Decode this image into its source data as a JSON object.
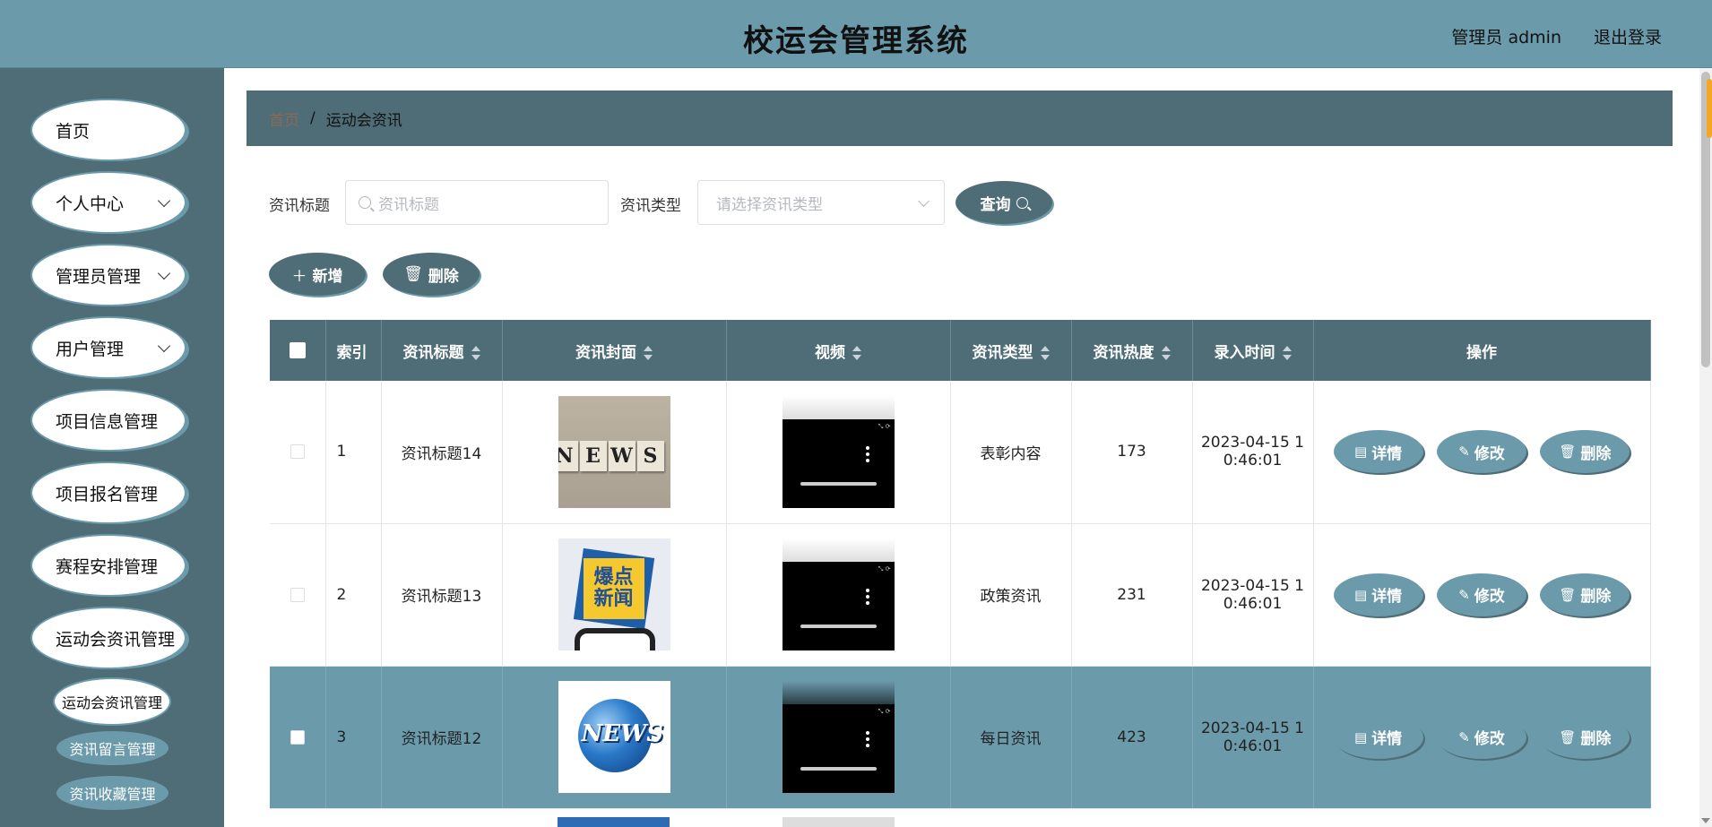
{
  "header": {
    "title": "校运会管理系统",
    "user": "管理员 admin",
    "logout": "退出登录"
  },
  "sidebar": {
    "items": [
      {
        "label": "首页"
      },
      {
        "label": "个人中心"
      },
      {
        "label": "管理员管理"
      },
      {
        "label": "用户管理"
      },
      {
        "label": "项目信息管理"
      },
      {
        "label": "项目报名管理"
      },
      {
        "label": "赛程安排管理"
      },
      {
        "label": "运动会资讯管理"
      }
    ],
    "subitems": [
      {
        "label": "运动会资讯管理"
      },
      {
        "label": "资讯留言管理"
      },
      {
        "label": "资讯收藏管理"
      }
    ]
  },
  "breadcrumb": {
    "home": "首页",
    "sep": "/",
    "current": "运动会资讯"
  },
  "filters": {
    "title_label": "资讯标题",
    "title_placeholder": "资讯标题",
    "type_label": "资讯类型",
    "type_placeholder": "请选择资讯类型",
    "query_label": "查询"
  },
  "actions": {
    "add_label": "新增",
    "delete_label": "删除"
  },
  "table": {
    "headers": {
      "index": "索引",
      "title": "资讯标题",
      "cover": "资讯封面",
      "video": "视频",
      "type": "资讯类型",
      "heat": "资讯热度",
      "time": "录入时间",
      "ops": "操作"
    },
    "rows": [
      {
        "index": "1",
        "title": "资讯标题14",
        "type": "表彰内容",
        "heat": "173",
        "time1": "2023-04-15 1",
        "time2": "0:46:01"
      },
      {
        "index": "2",
        "title": "资讯标题13",
        "type": "政策资讯",
        "heat": "231",
        "time1": "2023-04-15 1",
        "time2": "0:46:01"
      },
      {
        "index": "3",
        "title": "资讯标题12",
        "type": "每日资讯",
        "heat": "423",
        "time1": "2023-04-15 1",
        "time2": "0:46:01"
      }
    ],
    "ops": {
      "detail": "详情",
      "edit": "修改",
      "delete": "删除"
    }
  },
  "images": {
    "news1_letters": [
      "N",
      "E",
      "W",
      "S"
    ],
    "news2_line1": "爆点",
    "news2_line2": "新闻",
    "news3_text": "NEWS"
  },
  "colors": {
    "header_bg": "#6b9aab",
    "sidebar_bg": "#4f6d76",
    "accent": "#6b9aab",
    "highlight_row": "#6b9aab"
  }
}
